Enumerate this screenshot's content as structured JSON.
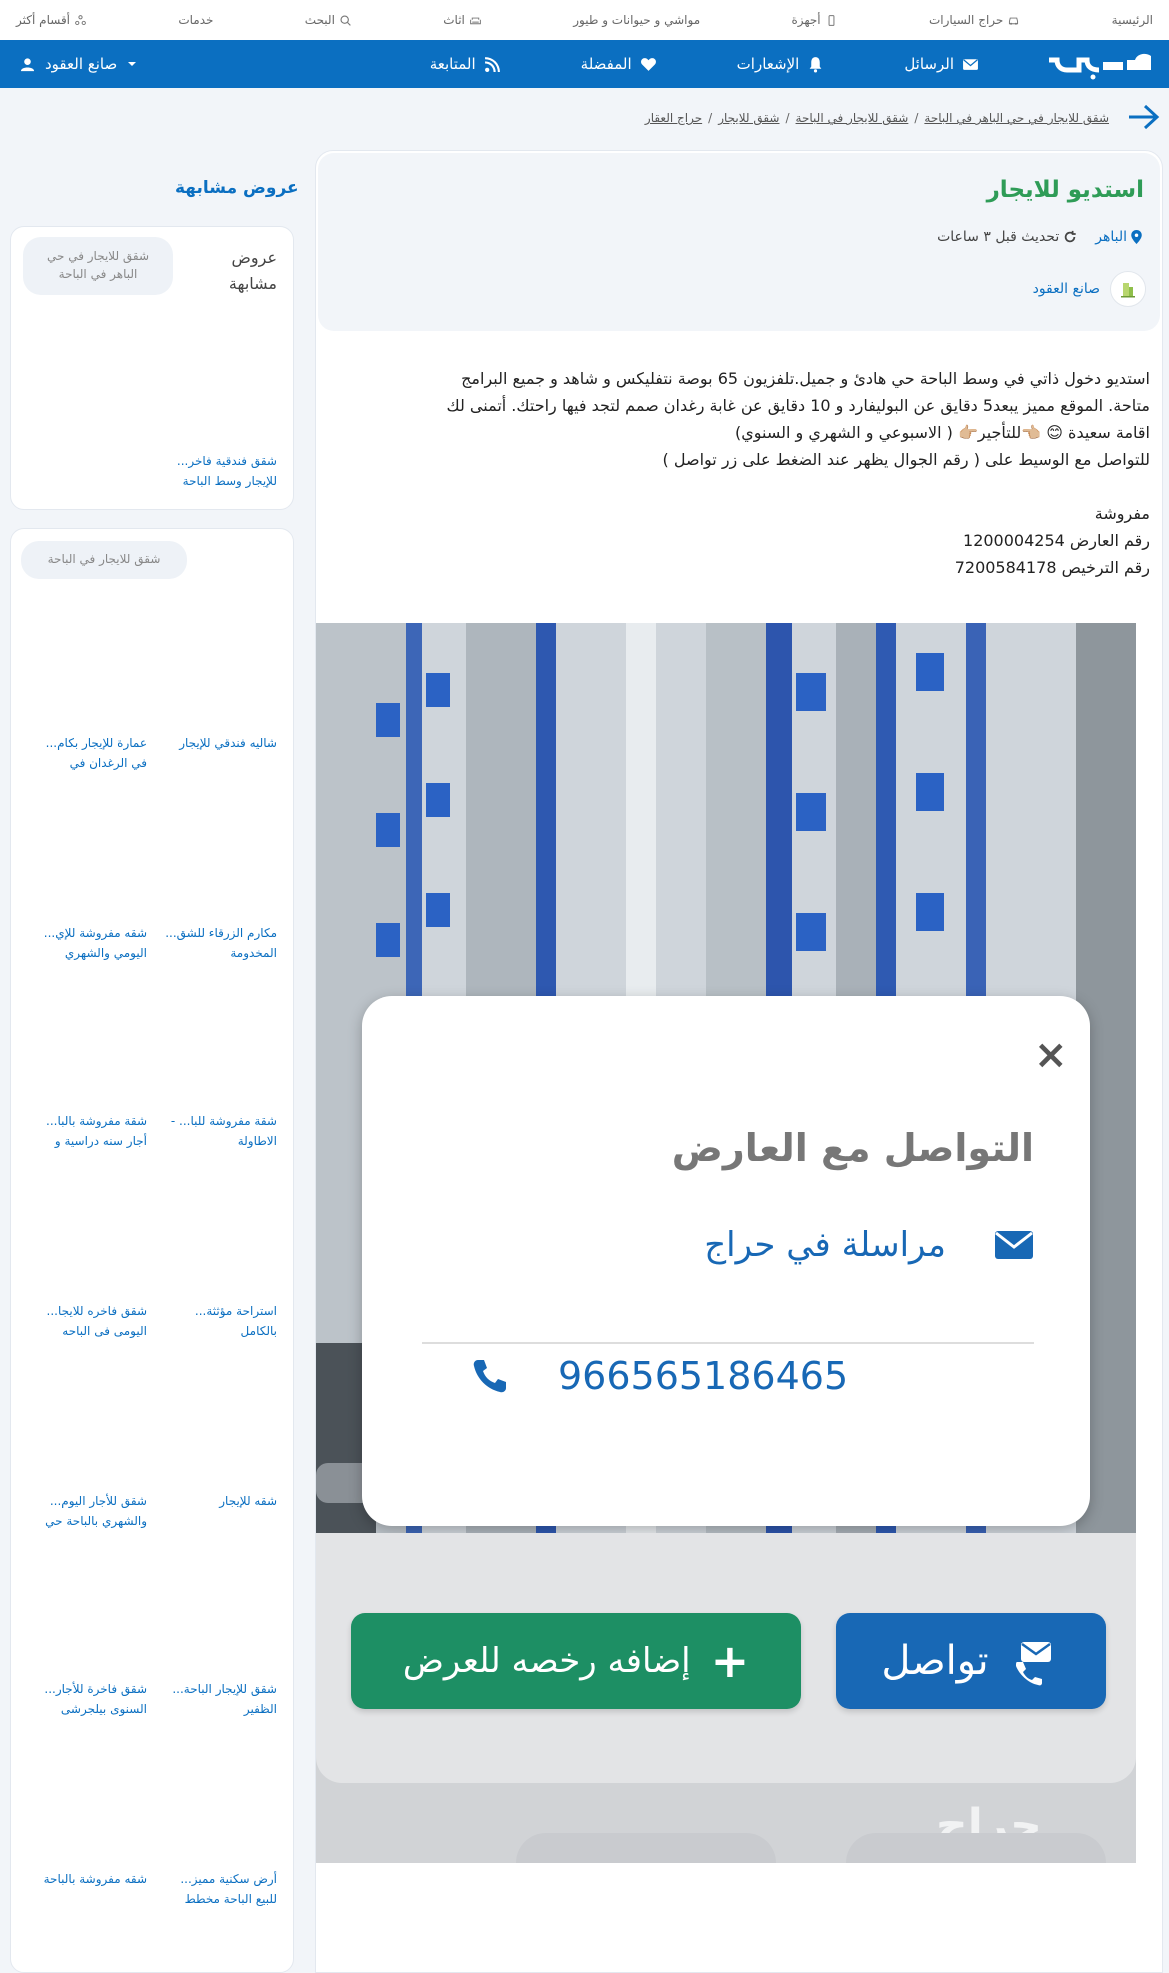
{
  "top_bar": {
    "items": [
      {
        "label": "الرئيسية"
      },
      {
        "label": "حراج السيارات"
      },
      {
        "label": "أجهزة"
      },
      {
        "label": "مواشي و حيوانات و طيور"
      },
      {
        "label": "اثاث"
      },
      {
        "label": "البحث"
      },
      {
        "label": "خدمات"
      },
      {
        "label": "أقسام أكثر"
      }
    ]
  },
  "nav": {
    "logo_text": "حراج",
    "items": [
      {
        "label": "الرسائل"
      },
      {
        "label": "الإشعارات"
      },
      {
        "label": "المفضلة"
      },
      {
        "label": "المتابعة"
      }
    ],
    "user_label": "صانع العقود"
  },
  "breadcrumb": {
    "items": [
      {
        "label": "حراج العقار"
      },
      {
        "label": "شقق للايجار"
      },
      {
        "label": "شقق للايجار في الباحة"
      },
      {
        "label": "شقق للايجار في حي الباهر في الباحة"
      }
    ]
  },
  "post": {
    "title": "استديو للايجار",
    "city": "الباهر",
    "updated": "تحديث قبل ٣ ساعات",
    "author": "صانع العقود",
    "description_lines": [
      "استديو دخول ذاتي في وسط الباحة حي هادئ و جميل.تلفزيون 65 بوصة نتفليكس و شاهد و جميع البرامج",
      "متاحة. الموقع مميز يبعد5 دقايق عن البوليفارد و 10 دقايق عن غابة رغدان صمم لتجد فيها راحتك. أتمنى لك",
      "اقامة سعيدة 😊 👈🏼للتأجير👉🏼 ( الاسبوعي و الشهري و السنوي)",
      "للتواصل مع الوسيط على  ( رقم الجوال يظهر عند الضغط على زر تواصل )"
    ],
    "description_lines_2": [
      "مفروشة",
      "رقم العارض 1200004254",
      "رقم الترخيص 7200584178"
    ]
  },
  "photo": {
    "modal": {
      "close": "×",
      "title": "التواصل مع العارض",
      "message_label": "مراسلة في حراج",
      "phone": "966565186465"
    },
    "contact_button": "تواصل",
    "license_button": "إضافه رخصه للعرض",
    "watermark": "حراج"
  },
  "sidebar": {
    "title": "عروض مشابهة",
    "card1": {
      "heading": "عروض مشابهة",
      "pill": "شقق للايجار في حي الباهر في الباحة",
      "link": "شقق فندقية فاخر... للإيجار وسط الباحة"
    },
    "card2": {
      "pill": "شقق للايجار في الباحة",
      "links": [
        "شاليه فندقي للإيجار",
        "عمارة للإيجار بكام... في الرغدان في",
        "مكارم الزرقاء للشق... المخدومة",
        "شقه مفروشة للإي... اليومي والشهري",
        "شقة مفروشة للبا... - الاطاولة",
        "شقة مفروشة بالبا... أجار سنه دراسية و",
        "استراحة مؤثثة... بالكامل",
        "شقق فاخره للايجا... اليومى فى الباحه",
        "شقه للإيجار",
        "شقق للأجار اليوم... والشهري بالباحة حي",
        "شقق للإيجار الباحة... الظفير",
        "شقق فاخرة للأجار... السنوى بيلجرشى",
        "أرض سكنية مميز... للبيع الباحة مخطط",
        "شقه مفروشة بالباحة"
      ]
    }
  }
}
